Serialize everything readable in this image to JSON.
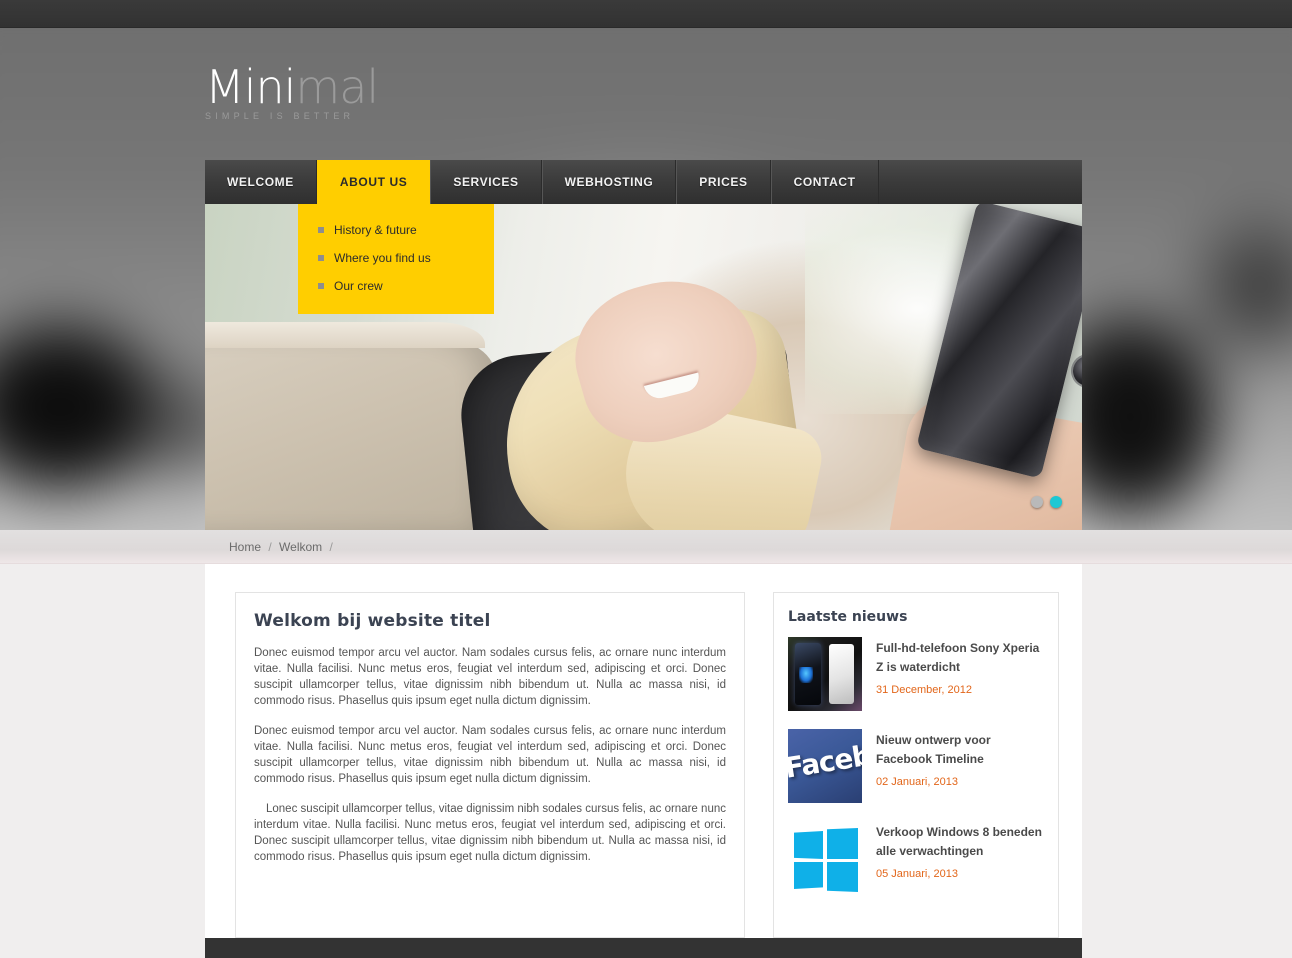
{
  "site": {
    "logo_primary": "Mini",
    "logo_secondary": "mal",
    "tagline": "SIMPLE IS BETTER",
    "accent_yellow": "#ffce00",
    "accent_orange": "#e2661a",
    "active_dot_color": "#1ec8d4",
    "dark_bar_color": "#333333"
  },
  "nav": {
    "items": [
      {
        "label": "WELCOME",
        "active": false
      },
      {
        "label": "ABOUT US",
        "active": true
      },
      {
        "label": "SERVICES",
        "active": false
      },
      {
        "label": "WEBHOSTING",
        "active": false
      },
      {
        "label": "PRICES",
        "active": false
      },
      {
        "label": "CONTACT",
        "active": false
      }
    ],
    "dropdown": {
      "parent": "ABOUT US",
      "items": [
        {
          "label": "History & future"
        },
        {
          "label": "Where you find us"
        },
        {
          "label": "Our crew"
        }
      ]
    }
  },
  "slider": {
    "dots": [
      {
        "active": false
      },
      {
        "active": true
      }
    ]
  },
  "breadcrumb": {
    "items": [
      "Home",
      "Welkom"
    ],
    "separator": "/",
    "trailing_separator": "/"
  },
  "main": {
    "title": "Welkom bij website titel",
    "paragraphs": [
      "Donec euismod tempor arcu vel auctor. Nam sodales cursus felis, ac ornare nunc interdum vitae. Nulla facilisi. Nunc metus eros, feugiat vel interdum sed, adipiscing et orci. Donec suscipit ullamcorper tellus, vitae dignissim nibh bibendum ut. Nulla ac massa nisi, id commodo risus. Phasellus quis ipsum eget nulla dictum dignissim.",
      "Donec euismod tempor arcu vel auctor. Nam sodales cursus felis, ac ornare nunc interdum vitae. Nulla facilisi. Nunc metus eros, feugiat vel interdum sed, adipiscing et orci. Donec suscipit ullamcorper tellus, vitae dignissim nibh bibendum ut. Nulla ac massa nisi, id commodo risus. Phasellus quis ipsum eget nulla dictum dignissim.",
      "Lonec suscipit ullamcorper tellus, vitae dignissim nibh sodales cursus felis, ac ornare nunc interdum vitae. Nulla facilisi. Nunc metus eros, feugiat vel interdum sed, adipiscing et orci. Donec suscipit ullamcorper tellus, vitae dignissim nibh bibendum ut. Nulla ac massa nisi, id commodo risus. Phasellus quis ipsum eget nulla dictum dignissim."
    ]
  },
  "news": {
    "title": "Laatste nieuws",
    "items": [
      {
        "headline": "Full-hd-telefoon Sony Xperia Z is waterdicht",
        "date": "31 December, 2012",
        "thumb": "sony-xperia-thumbnail"
      },
      {
        "headline": "Nieuw ontwerp voor Facebook Timeline",
        "date": "02 Januari, 2013",
        "thumb": "facebook-logo-thumbnail",
        "thumb_text": "Facebook"
      },
      {
        "headline": "Verkoop Windows 8 beneden alle verwachtingen",
        "date": "05 Januari, 2013",
        "thumb": "windows-8-logo-thumbnail"
      }
    ]
  }
}
